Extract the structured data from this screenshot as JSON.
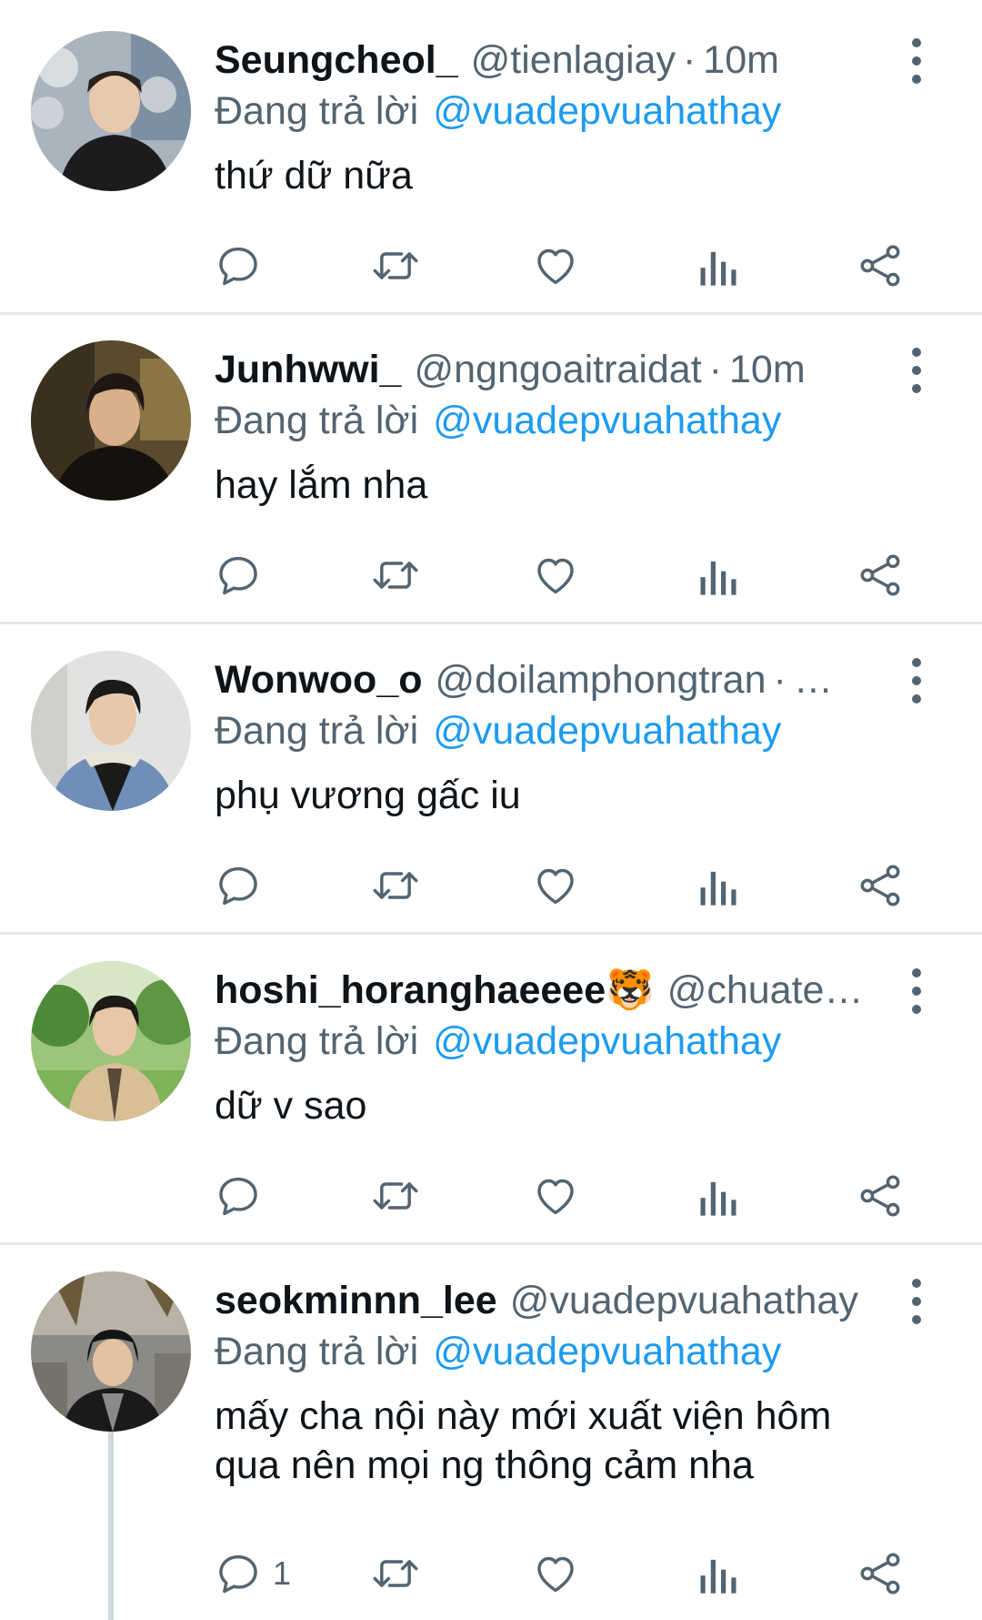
{
  "colors": {
    "accent": "#1d9bf0",
    "secondary_text": "#536471",
    "divider": "#e6e9ec",
    "action_icon": "#536471"
  },
  "icons": [
    "reply-icon",
    "retweet-icon",
    "like-icon",
    "views-icon",
    "share-icon",
    "more-icon"
  ],
  "tweets": [
    {
      "name": "Seungcheol_",
      "handle": "@tienlagiay",
      "separator": "·",
      "time": "10m",
      "emoji": "",
      "reply_prefix": "Đang trả lời",
      "reply_to": "@vuadepvuahathay",
      "text": "thứ dữ nữa",
      "reply_count": ""
    },
    {
      "name": "Junhwwi_",
      "handle": "@ngngoaitraidat",
      "separator": "·",
      "time": "10m",
      "emoji": "",
      "reply_prefix": "Đang trả lời",
      "reply_to": "@vuadepvuahathay",
      "text": "hay lắm nha",
      "reply_count": ""
    },
    {
      "name": "Wonwoo_o",
      "handle": "@doilamphongtran",
      "separator": "·",
      "time": "…",
      "emoji": "",
      "reply_prefix": "Đang trả lời",
      "reply_to": "@vuadepvuahathay",
      "text": "phụ vương gấc iu",
      "reply_count": ""
    },
    {
      "name": "hoshi_horanghaeeee",
      "handle": "@chuatenha",
      "separator": "",
      "time": "",
      "emoji": "🐯",
      "reply_prefix": "Đang trả lời",
      "reply_to": "@vuadepvuahathay",
      "text": "dữ v sao",
      "reply_count": ""
    },
    {
      "name": "seokminnn_lee",
      "handle": "@vuadepvuahathay",
      "separator": "",
      "time": "",
      "emoji": "",
      "reply_prefix": "Đang trả lời",
      "reply_to": "@vuadepvuahathay",
      "text": "mấy cha nội này mới xuất viện hôm qua nên mọi ng thông cảm nha",
      "reply_count": "1"
    }
  ]
}
